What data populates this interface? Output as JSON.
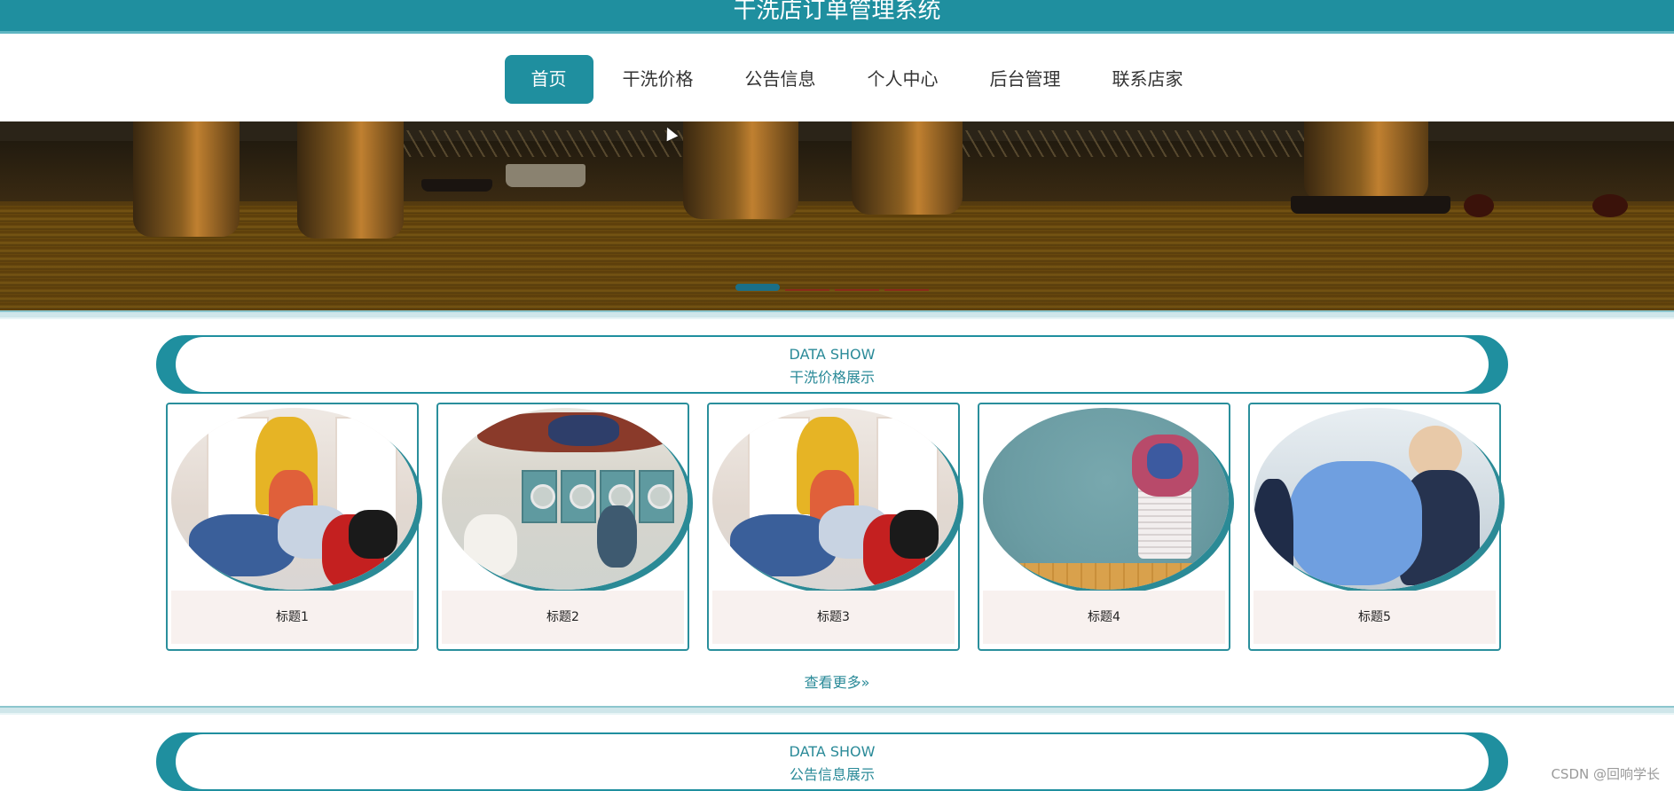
{
  "header": {
    "title": "干洗店订单管理系统"
  },
  "nav": {
    "items": [
      {
        "label": "首页",
        "active": true
      },
      {
        "label": "干洗价格"
      },
      {
        "label": "公告信息"
      },
      {
        "label": "个人中心"
      },
      {
        "label": "后台管理"
      },
      {
        "label": "联系店家"
      }
    ]
  },
  "banner": {
    "slides": 4,
    "active_slide": 1,
    "image": "river-bridge-night"
  },
  "sections": [
    {
      "en": "DATA SHOW",
      "cn": "干洗价格展示"
    },
    {
      "en": "DATA SHOW",
      "cn": "公告信息展示"
    }
  ],
  "cards": [
    {
      "title": "标题1",
      "image": "woman-with-laundry-basket"
    },
    {
      "title": "标题2",
      "image": "laundromat-washers"
    },
    {
      "title": "标题3",
      "image": "woman-with-laundry-basket"
    },
    {
      "title": "标题4",
      "image": "laundry-hamper-teal-wall"
    },
    {
      "title": "标题5",
      "image": "dry-cleaner-handing-garment"
    }
  ],
  "more_link": "查看更多",
  "more_icon": "double-chevron-right-icon",
  "watermark": "CSDN @回响学长",
  "colors": {
    "primary": "#1f8f9f",
    "caption_bg": "#f8f1ef"
  }
}
